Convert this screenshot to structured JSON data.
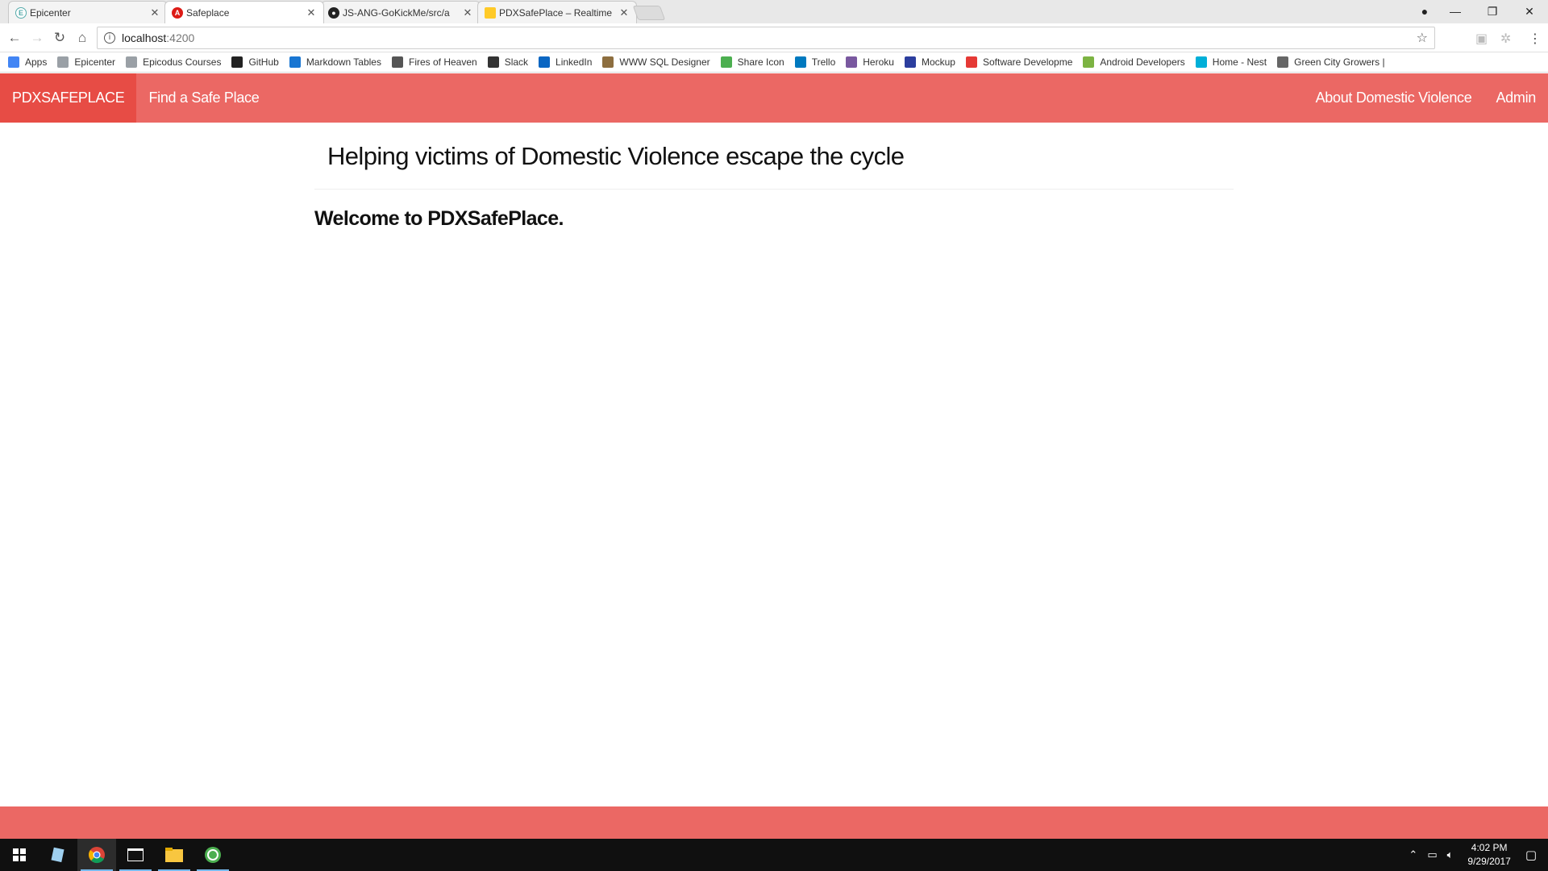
{
  "browser": {
    "tabs": [
      {
        "title": "Epicenter",
        "favicon": "epicenter-icon",
        "active": false
      },
      {
        "title": "Safeplace",
        "favicon": "angular-icon",
        "active": true
      },
      {
        "title": "JS-ANG-GoKickMe/src/a",
        "favicon": "github-icon",
        "active": false
      },
      {
        "title": "PDXSafePlace – Realtime",
        "favicon": "firebase-icon",
        "active": false
      }
    ],
    "url_host": "localhost",
    "url_port": ":4200",
    "bookmarks": [
      {
        "label": "Apps",
        "icon": "apps-grid-icon",
        "color": "#4285f4"
      },
      {
        "label": "Epicenter",
        "icon": "epicenter-icon",
        "color": "#9aa0a6"
      },
      {
        "label": "Epicodus Courses",
        "icon": "epicenter-icon",
        "color": "#9aa0a6"
      },
      {
        "label": "GitHub",
        "icon": "github-icon",
        "color": "#222222"
      },
      {
        "label": "Markdown Tables",
        "icon": "table-icon",
        "color": "#1976d2"
      },
      {
        "label": "Fires of Heaven",
        "icon": "wings-icon",
        "color": "#555555"
      },
      {
        "label": "Slack",
        "icon": "hash-icon",
        "color": "#333333"
      },
      {
        "label": "LinkedIn",
        "icon": "linkedin-icon",
        "color": "#0a66c2"
      },
      {
        "label": "WWW SQL Designer",
        "icon": "person-icon",
        "color": "#8d6e3f"
      },
      {
        "label": "Share Icon",
        "icon": "share-icon",
        "color": "#4caf50"
      },
      {
        "label": "Trello",
        "icon": "trello-icon",
        "color": "#0079bf"
      },
      {
        "label": "Heroku",
        "icon": "heroku-icon",
        "color": "#79589f"
      },
      {
        "label": "Mockup",
        "icon": "mockup-icon",
        "color": "#2c3e9e"
      },
      {
        "label": "Software Developme",
        "icon": "xda-icon",
        "color": "#e53935"
      },
      {
        "label": "Android Developers",
        "icon": "android-icon",
        "color": "#7cb342"
      },
      {
        "label": "Home - Nest",
        "icon": "nest-icon",
        "color": "#00afd8"
      },
      {
        "label": "Green City Growers |",
        "icon": "tractor-icon",
        "color": "#666666"
      }
    ]
  },
  "app": {
    "brand": "PDXSAFEPLACE",
    "nav_left": "Find a Safe Place",
    "nav_about": "About Domestic Violence",
    "nav_admin": "Admin",
    "heading": "Helping victims of Domestic Violence escape the cycle",
    "welcome": "Welcome to PDXSafePlace.",
    "theme_color": "#eb6864"
  },
  "taskbar": {
    "time": "4:02 PM",
    "date": "9/29/2017"
  }
}
